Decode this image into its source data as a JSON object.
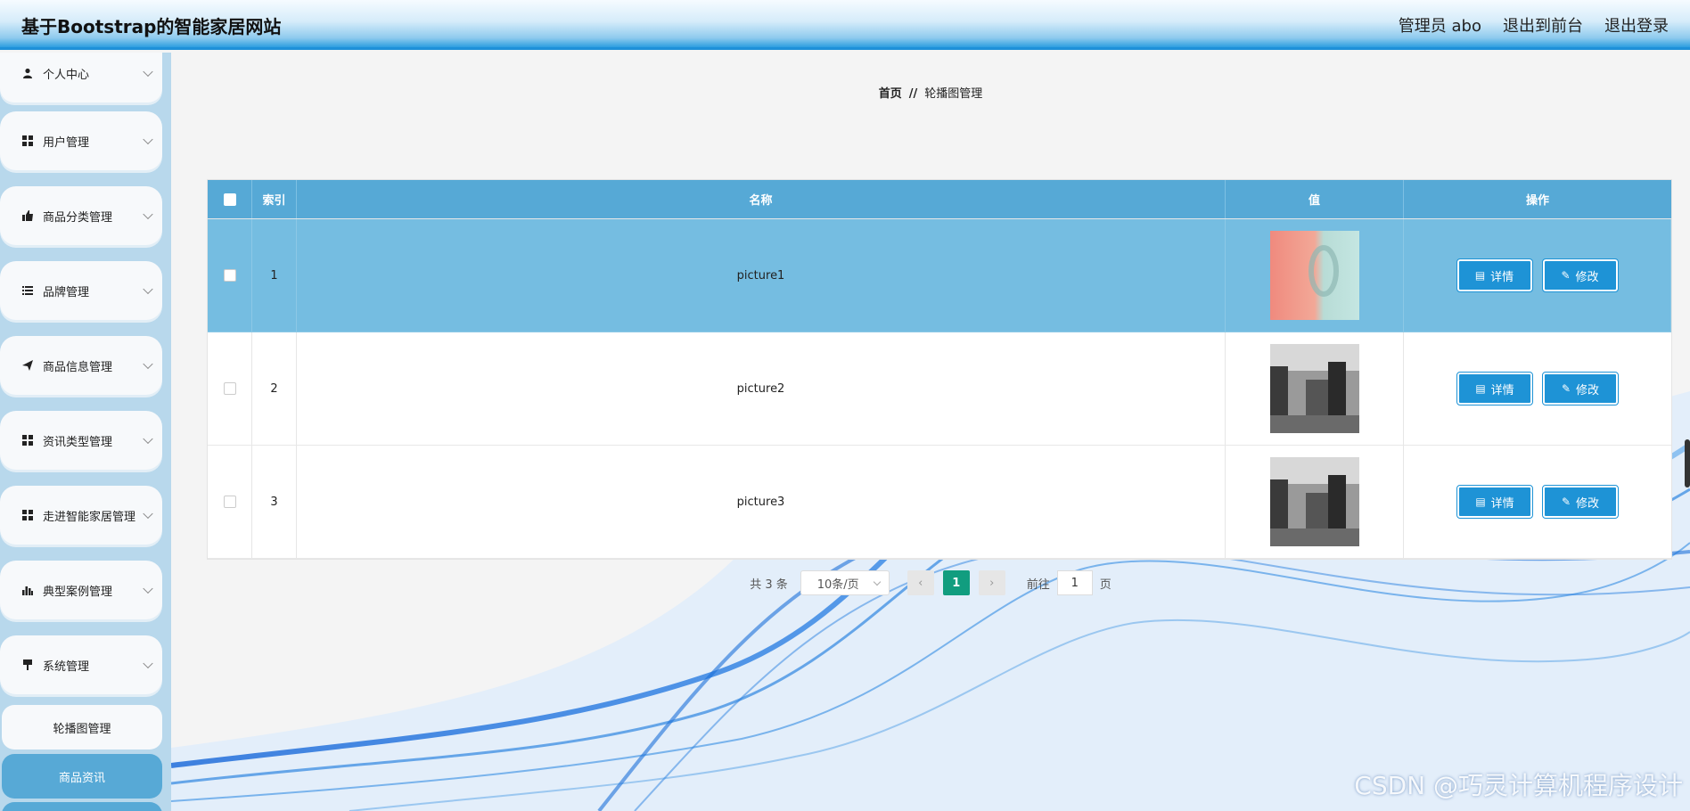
{
  "header": {
    "title": "基于Bootstrap的智能家居网站",
    "links": [
      "管理员 abo",
      "退出到前台",
      "退出登录"
    ]
  },
  "sidebar": {
    "items": [
      {
        "label": "个人中心",
        "icon": "user-icon"
      },
      {
        "label": "用户管理",
        "icon": "grid-icon"
      },
      {
        "label": "商品分类管理",
        "icon": "thumbs-up-icon"
      },
      {
        "label": "品牌管理",
        "icon": "list-icon"
      },
      {
        "label": "商品信息管理",
        "icon": "paper-plane-icon"
      },
      {
        "label": "资讯类型管理",
        "icon": "grid-icon"
      },
      {
        "label": "走进智能家居管理",
        "icon": "grid-icon"
      },
      {
        "label": "典型案例管理",
        "icon": "bar-chart-icon"
      },
      {
        "label": "系统管理",
        "icon": "pin-icon"
      }
    ],
    "sub_items": [
      {
        "label": "轮播图管理",
        "active": false
      },
      {
        "label": "商品资讯",
        "active": true
      }
    ]
  },
  "breadcrumb": {
    "home": "首页",
    "separator": "//",
    "current": "轮播图管理"
  },
  "table": {
    "headers": {
      "index": "索引",
      "name": "名称",
      "value": "值",
      "actions": "操作"
    },
    "rows": [
      {
        "index": "1",
        "name": "picture1",
        "highlighted": true
      },
      {
        "index": "2",
        "name": "picture2",
        "highlighted": false
      },
      {
        "index": "3",
        "name": "picture3",
        "highlighted": false
      }
    ],
    "detail_label": "详情",
    "edit_label": "修改"
  },
  "pagination": {
    "total": "共 3 条",
    "page_size": "10条/页",
    "current_page": "1",
    "goto_prefix": "前往",
    "goto_value": "1",
    "goto_suffix": "页"
  },
  "watermark": "CSDN @巧灵计算机程序设计",
  "colors": {
    "accent": "#1e93d6",
    "header_row": "#56a9d6",
    "active_page": "#119d7f",
    "highlight_row": "#75bde1"
  }
}
